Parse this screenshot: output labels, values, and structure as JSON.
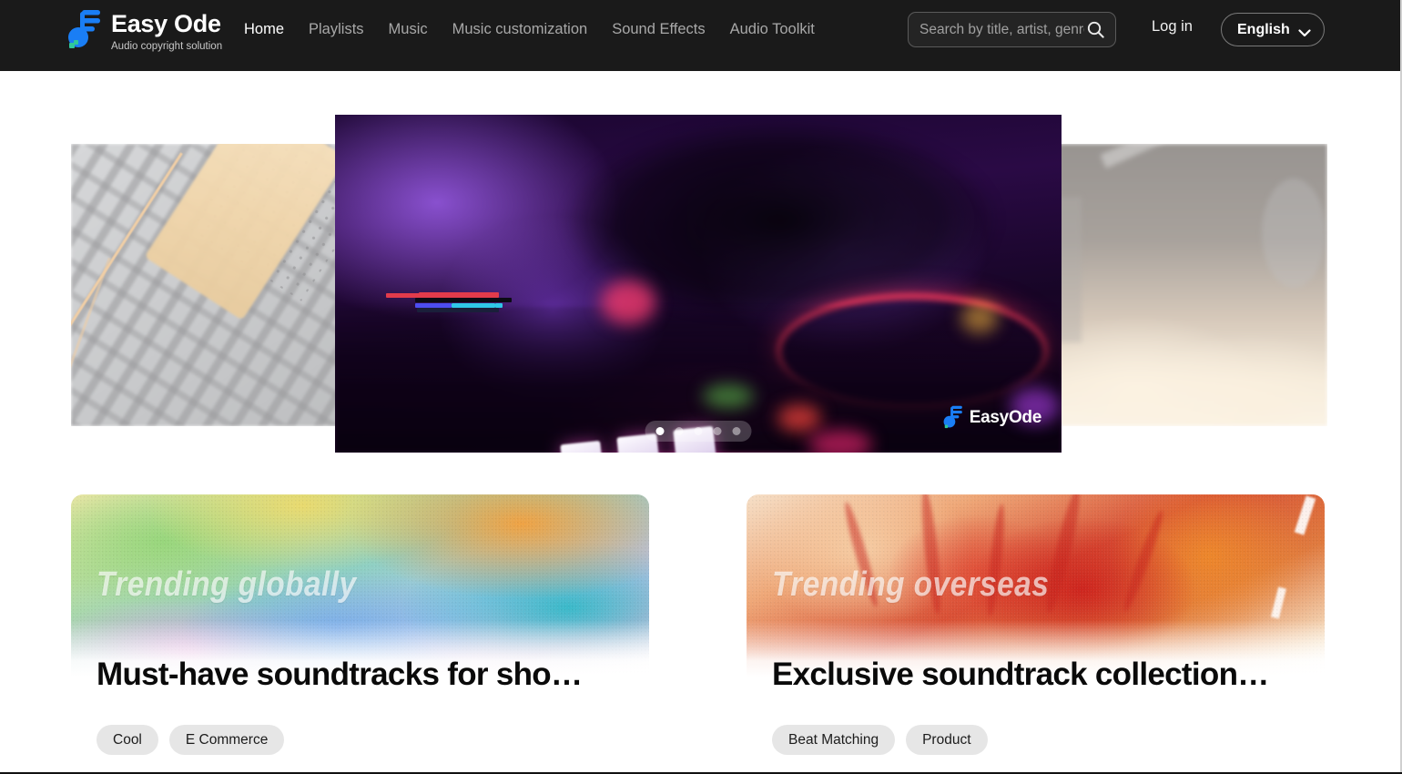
{
  "brand": {
    "name": "Easy Ode",
    "tagline": "Audio copyright solution",
    "logo_icon": "music-note-icon",
    "accent_color": "#1a7ef5",
    "accent_secondary": "#2fc89a"
  },
  "header": {
    "background_color": "#1a1a1a",
    "nav": [
      {
        "label": "Home",
        "active": true
      },
      {
        "label": "Playlists",
        "active": false
      },
      {
        "label": "Music",
        "active": false
      },
      {
        "label": "Music customization",
        "active": false
      },
      {
        "label": "Sound Effects",
        "active": false
      },
      {
        "label": "Audio Toolkit",
        "active": false
      }
    ],
    "search": {
      "placeholder": "Search by title, artist, genre",
      "value": "",
      "icon": "search-icon"
    },
    "login_label": "Log in",
    "language": {
      "label": "English",
      "icon": "chevron-down-icon"
    }
  },
  "carousel": {
    "slides": [
      {
        "alt": "Grey circuit board tech pattern with gold accents",
        "position": "left"
      },
      {
        "alt": "DJ mixer with hand over turntable under purple lighting",
        "position": "center",
        "active": true
      },
      {
        "alt": "Faded sepia concert stage scene",
        "position": "right"
      }
    ],
    "watermark": "EasyOde",
    "dots": [
      {
        "active": true
      },
      {
        "active": false
      },
      {
        "active": false
      },
      {
        "active": false
      },
      {
        "active": false
      }
    ]
  },
  "cards": [
    {
      "overlay_text": "Trending globally",
      "title": "Must-have soundtracks for sho…",
      "tags": [
        "Cool",
        "E Commerce"
      ],
      "art": "rainbow-grain"
    },
    {
      "overlay_text": "Trending overseas",
      "title": "Exclusive soundtrack collection…",
      "tags": [
        "Beat Matching",
        "Product"
      ],
      "art": "red-feather"
    }
  ]
}
